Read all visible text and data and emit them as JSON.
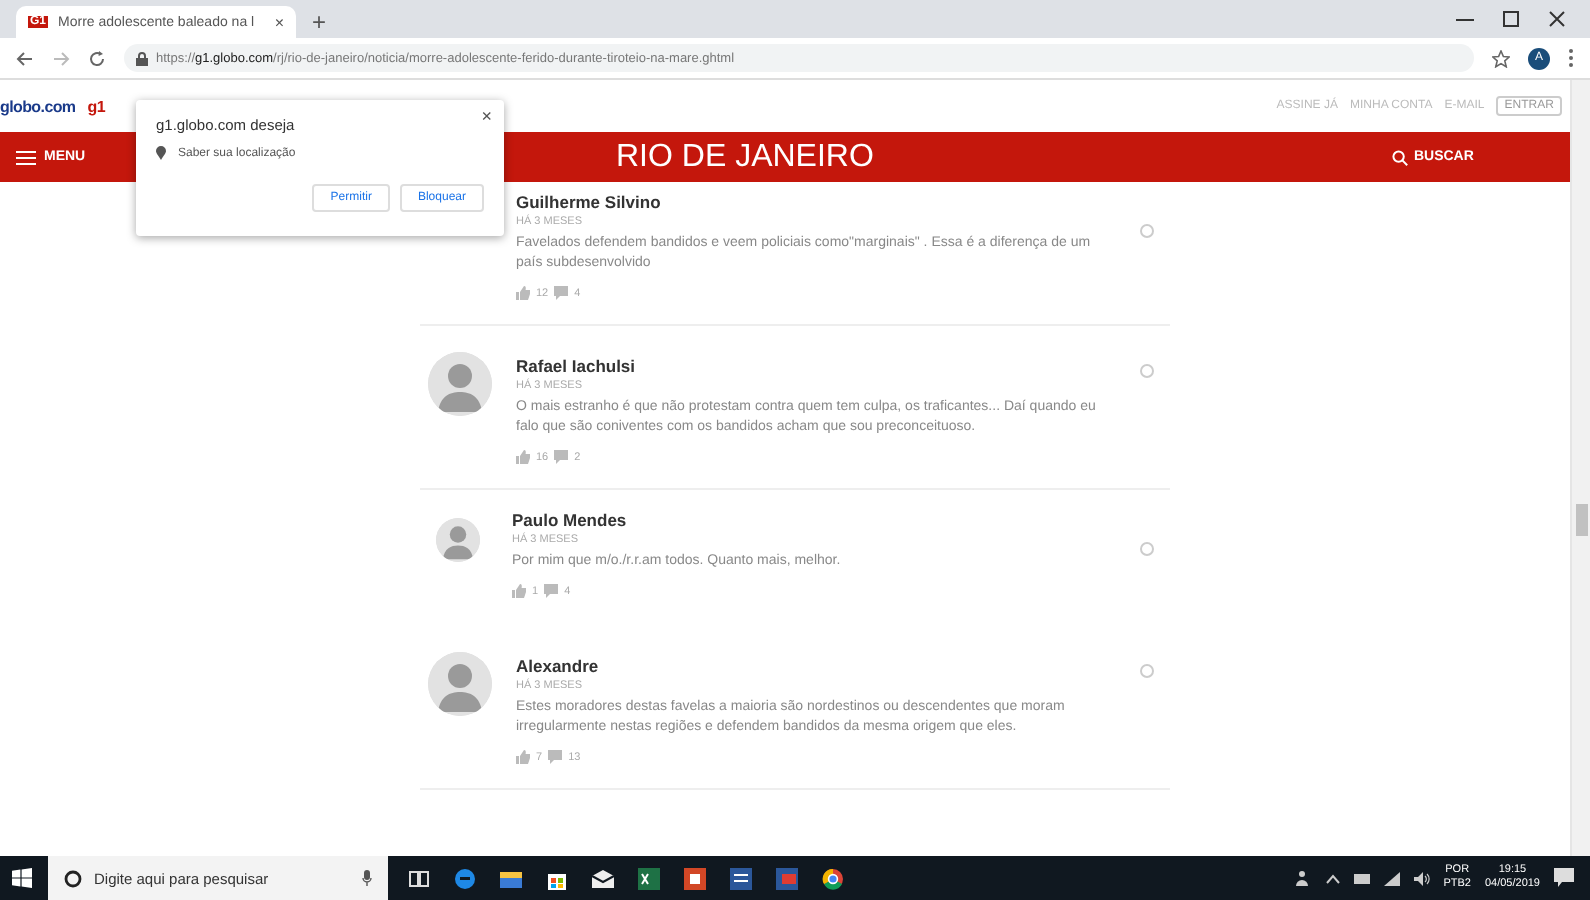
{
  "browser": {
    "tab": {
      "favicon": "G1",
      "title": "Morre adolescente baleado na l",
      "close": "×"
    },
    "new_tab": "+",
    "url": "https://**g1.globo.com**/rj/rio-de-janeiro/noticia/morre-adolescente-ferido-durante-tiroteio-na-mare.ghtml",
    "profile_initial": "A"
  },
  "globo_bar": {
    "left": [
      "globo.com",
      "g1"
    ],
    "right": [
      "ASSINE JÁ",
      "MINHA CONTA",
      "E-MAIL",
      "ENTRAR"
    ]
  },
  "header": {
    "menu": "MENU",
    "title": "RIO DE JANEIRO",
    "search": "BUSCAR"
  },
  "popup": {
    "title": "g1.globo.com deseja",
    "permission": "Saber sua localização",
    "buttons": [
      "Permitir",
      "Bloquear"
    ],
    "close": "×"
  },
  "comments": [
    {
      "kind": "comment",
      "name": "Guilherme Silvino",
      "time": "HÁ 3 MESES",
      "text": "Favelados defendem bandidos e veem policiais como\"marginais\" . Essa é a diferença de um país subdesenvolvido",
      "likes": "12",
      "replies": "4",
      "avatar": false
    },
    {
      "kind": "comment",
      "name": "Rafael Iachulsi",
      "time": "HÁ 3 MESES",
      "text": "O mais estranho é que não protestam contra quem tem culpa, os traficantes... Daí quando eu falo que são coniventes com os bandidos acham que sou preconceituoso.",
      "likes": "16",
      "replies": "2",
      "avatar": true
    },
    {
      "kind": "reply",
      "name": "Paulo Mendes",
      "time": "HÁ 3 MESES",
      "text": "Por mim que m/o./r.r.am todos. Quanto mais, melhor.",
      "likes": "1",
      "replies": "4",
      "avatar": true
    },
    {
      "kind": "comment",
      "name": "Alexandre",
      "time": "HÁ 3 MESES",
      "text": "Estes moradores destas favelas a maioria são nordestinos ou descendentes que moram irregularmente nestas regiões e defendem bandidos da mesma origem que eles.",
      "likes": "7",
      "replies": "13",
      "avatar": true
    }
  ],
  "taskbar": {
    "search_placeholder": "Digite aqui para pesquisar",
    "language": "POR",
    "layout": "PTB2",
    "time": "19:15",
    "date": "04/05/2019"
  }
}
